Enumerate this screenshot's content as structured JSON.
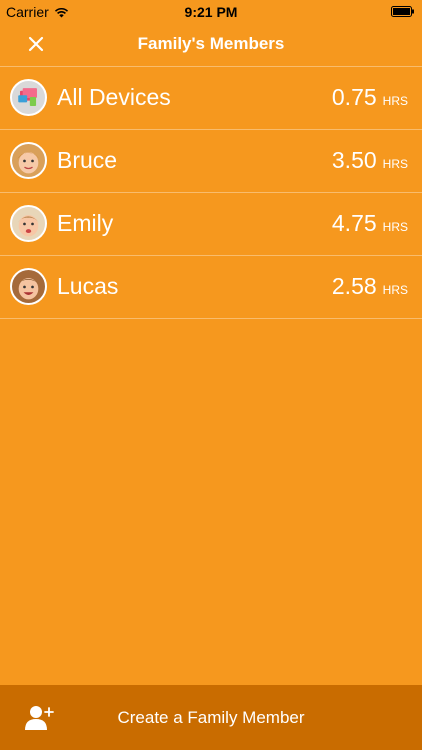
{
  "status_bar": {
    "carrier": "Carrier",
    "time": "9:21 PM"
  },
  "header": {
    "title": "Family's Members",
    "close_icon": "close-icon"
  },
  "members": [
    {
      "name": "All Devices",
      "hours": "0.75",
      "unit": "HRS",
      "avatar": "devices-icon"
    },
    {
      "name": "Bruce",
      "hours": "3.50",
      "unit": "HRS",
      "avatar": "child-avatar"
    },
    {
      "name": "Emily",
      "hours": "4.75",
      "unit": "HRS",
      "avatar": "child-avatar"
    },
    {
      "name": "Lucas",
      "hours": "2.58",
      "unit": "HRS",
      "avatar": "child-avatar"
    }
  ],
  "footer": {
    "label": "Create a Family Member",
    "icon": "add-user-icon"
  },
  "colors": {
    "background": "#F6981E",
    "footer": "#C96C00",
    "text": "#FFFFFF"
  }
}
